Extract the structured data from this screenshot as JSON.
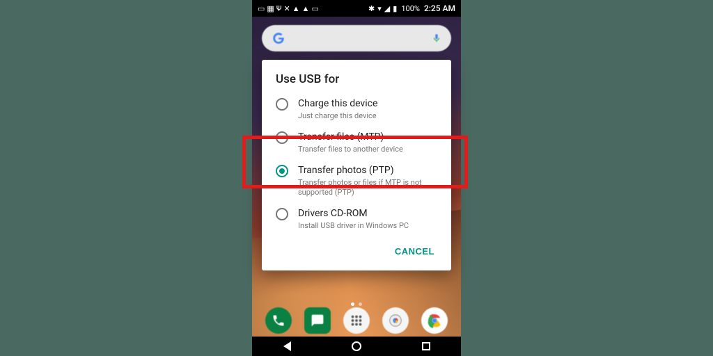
{
  "status": {
    "battery_pct": "100%",
    "time": "2:25 AM"
  },
  "dialog": {
    "title": "Use USB for",
    "options": [
      {
        "label": "Charge this device",
        "desc": "Just charge this device",
        "selected": false
      },
      {
        "label": "Transfer files (MTP)",
        "desc": "Transfer files to another device",
        "selected": false
      },
      {
        "label": "Transfer photos (PTP)",
        "desc": "Transfer photos or files if MTP is not supported (PTP)",
        "selected": true
      },
      {
        "label": "Drivers CD-ROM",
        "desc": "Install USB driver in Windows PC",
        "selected": false
      }
    ],
    "cancel": "CANCEL"
  },
  "highlight_index": 2,
  "colors": {
    "accent": "#009688",
    "highlight": "#e21b1b"
  }
}
